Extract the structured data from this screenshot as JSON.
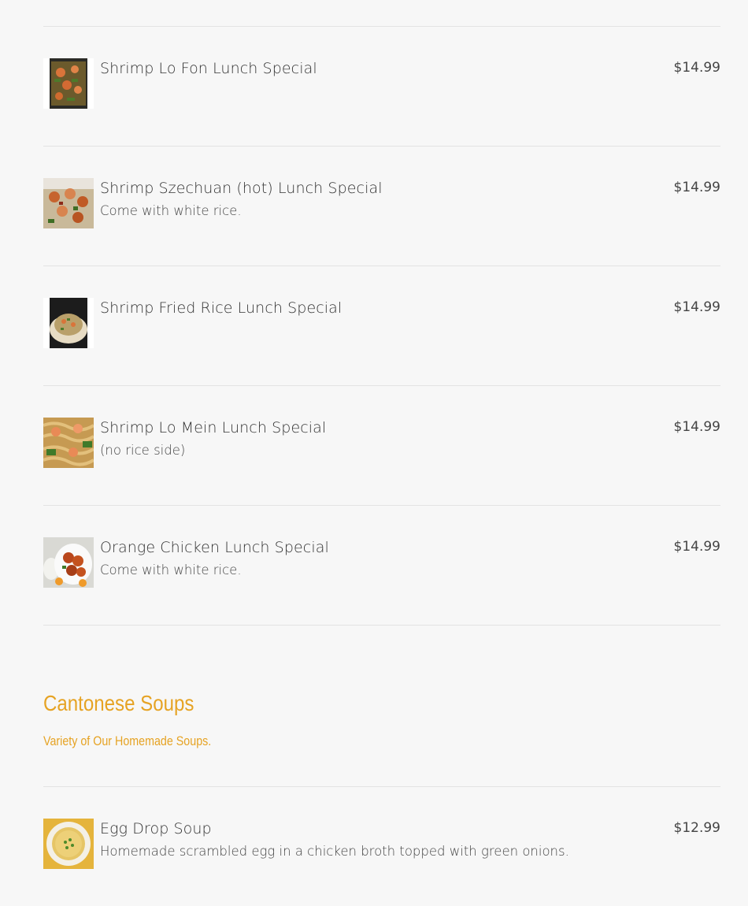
{
  "menu": {
    "items": [
      {
        "name": "Shrimp Lo Fon Lunch Special",
        "description": "",
        "price": "$14.99",
        "image": "shrimp-lo-fon-photo"
      },
      {
        "name": "Shrimp Szechuan (hot) Lunch Special",
        "description": "Come with white rice.",
        "price": "$14.99",
        "image": "shrimp-szechuan-photo"
      },
      {
        "name": "Shrimp Fried Rice Lunch Special",
        "description": "",
        "price": "$14.99",
        "image": "shrimp-fried-rice-photo"
      },
      {
        "name": "Shrimp Lo Mein Lunch Special",
        "description": "(no rice side)",
        "price": "$14.99",
        "image": "shrimp-lo-mein-photo"
      },
      {
        "name": "Orange Chicken Lunch Special",
        "description": "Come with white rice.",
        "price": "$14.99",
        "image": "orange-chicken-photo"
      }
    ],
    "section": {
      "title": "Cantonese Soups",
      "subtitle": "Variety of Our Homemade Soups."
    },
    "soup_items": [
      {
        "name": "Egg Drop Soup",
        "description": "Homemade scrambled egg in a chicken broth topped with green onions.",
        "price": "$12.99",
        "image": "egg-drop-soup-photo"
      }
    ],
    "colors": {
      "accent": "#e6a324",
      "background": "#f7f7f7",
      "divider": "#e3e3e3"
    }
  }
}
